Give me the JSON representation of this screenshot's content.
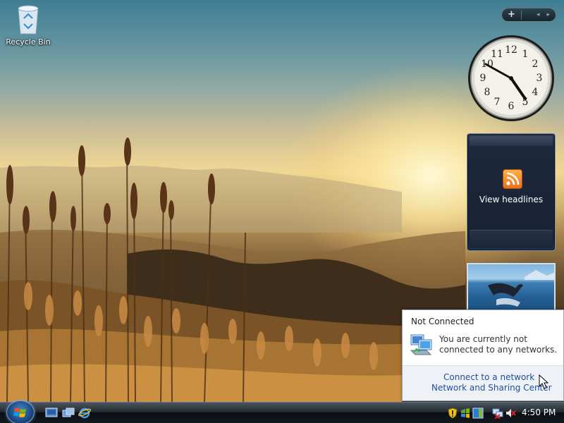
{
  "desktop": {
    "icons": [
      {
        "label": "Recycle Bin",
        "icon": "recycle-bin-icon"
      }
    ]
  },
  "sidebar": {
    "controls": {
      "add_label": "+",
      "prev_label": "◂",
      "next_label": "▸"
    },
    "clock": {
      "numerals": [
        "12",
        "1",
        "2",
        "3",
        "4",
        "5",
        "6",
        "7",
        "8",
        "9",
        "10",
        "11"
      ]
    },
    "feed_gadget": {
      "label": "View headlines",
      "icon": "rss-icon"
    },
    "slideshow": {
      "icon": "whale-photo"
    }
  },
  "network_popup": {
    "title": "Not Connected",
    "message": "You are currently not connected to any networks.",
    "links": [
      "Connect to a network",
      "Network and Sharing Center"
    ]
  },
  "taskbar": {
    "start_icon": "windows-orb-icon",
    "quick_launch": [
      "show-desktop-icon",
      "switch-windows-icon",
      "internet-explorer-icon"
    ],
    "tray_icons": [
      "security-shield-icon",
      "windows-update-icon",
      "sidebar-icon",
      "network-disconnected-icon",
      "volume-muted-icon"
    ],
    "time": "4:50 PM"
  }
}
